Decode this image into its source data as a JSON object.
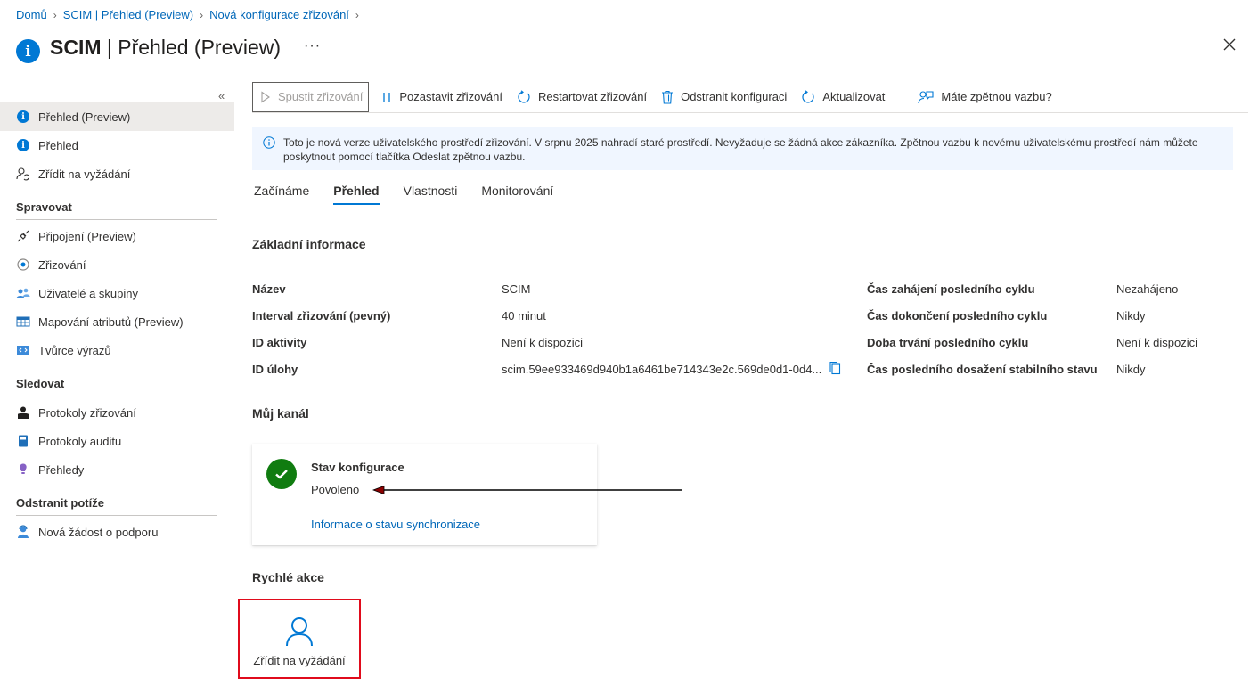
{
  "breadcrumb": [
    "Domů",
    "SCIM | Přehled (Preview)",
    "Nová konfigurace zřizování"
  ],
  "title": {
    "bold": "SCIM",
    "rest": " | Přehled (Preview)",
    "more": "···"
  },
  "sidebar": {
    "collapse": "«",
    "top_items": [
      {
        "label": "Přehled (Preview)",
        "icon": "info-icon",
        "active": true
      },
      {
        "label": "Přehled",
        "icon": "info-icon"
      },
      {
        "label": "Zřídit na vyžádání",
        "icon": "person-sync-icon"
      }
    ],
    "sections": [
      {
        "title": "Spravovat",
        "items": [
          {
            "label": "Připojení (Preview)",
            "icon": "plug-icon"
          },
          {
            "label": "Zřizování",
            "icon": "provisioning-icon"
          },
          {
            "label": "Uživatelé a skupiny",
            "icon": "users-icon"
          },
          {
            "label": "Mapování atributů (Preview)",
            "icon": "table-icon"
          },
          {
            "label": "Tvůrce výrazů",
            "icon": "code-icon"
          }
        ]
      },
      {
        "title": "Sledovat",
        "items": [
          {
            "label": "Protokoly zřizování",
            "icon": "person-log-icon"
          },
          {
            "label": "Protokoly auditu",
            "icon": "book-icon"
          },
          {
            "label": "Přehledy",
            "icon": "bulb-icon"
          }
        ]
      },
      {
        "title": "Odstranit potíže",
        "items": [
          {
            "label": "Nová žádost o podporu",
            "icon": "support-icon"
          }
        ]
      }
    ]
  },
  "toolbar": {
    "start": "Spustit zřizování",
    "pause": "Pozastavit zřizování",
    "restart": "Restartovat zřizování",
    "delete": "Odstranit konfiguraci",
    "refresh": "Aktualizovat",
    "feedback": "Máte zpětnou vazbu?"
  },
  "banner": "Toto je nová verze uživatelského prostředí zřizování. V srpnu 2025 nahradí staré prostředí. Nevyžaduje se žádná akce zákazníka. Zpětnou vazbu k novému uživatelskému prostředí nám můžete poskytnout pomocí tlačítka Odeslat zpětnou vazbu.",
  "tabs": [
    "Začínáme",
    "Přehled",
    "Vlastnosti",
    "Monitorování"
  ],
  "active_tab": "Přehled",
  "basic": {
    "heading": "Základní informace",
    "left": [
      {
        "k": "Název",
        "v": "SCIM"
      },
      {
        "k": "Interval zřizování (pevný)",
        "v": "40 minut"
      },
      {
        "k": "ID aktivity",
        "v": "Není k dispozici"
      },
      {
        "k": "ID úlohy",
        "v": "scim.59ee933469d940b1a6461be714343e2c.569de0d1-0d4..."
      }
    ],
    "right": [
      {
        "k": "Čas zahájení posledního cyklu",
        "v": "Nezahájeno"
      },
      {
        "k": "Čas dokončení posledního cyklu",
        "v": "Nikdy"
      },
      {
        "k": "Doba trvání posledního cyklu",
        "v": "Není k dispozici"
      },
      {
        "k": "Čas posledního dosažení stabilního stavu",
        "v": "Nikdy"
      }
    ]
  },
  "channel": {
    "heading": "Můj kanál",
    "card_title": "Stav konfigurace",
    "card_status": "Povoleno",
    "card_link": "Informace o stavu synchronizace"
  },
  "quick": {
    "heading": "Rychlé akce",
    "tile": "Zřídit na vyžádání"
  },
  "colors": {
    "accent": "#0078d4",
    "success": "#107c10",
    "highlight": "#e00b1c"
  }
}
